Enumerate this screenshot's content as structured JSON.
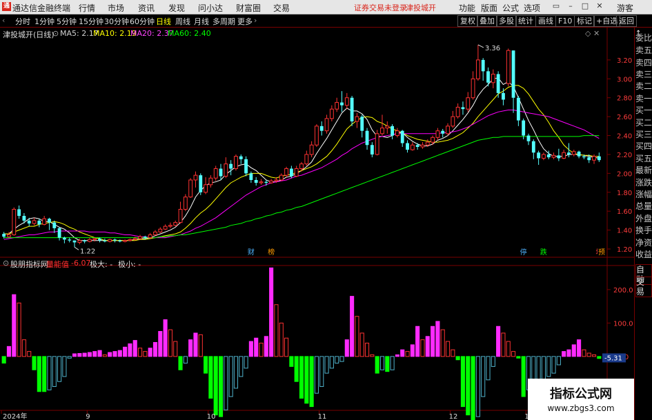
{
  "app": {
    "title": "通达信金融终端",
    "logo": "通",
    "menus": [
      "行情",
      "市场",
      "资讯",
      "发现",
      "问小达",
      "财富圈",
      "交易"
    ],
    "notice": "证券交易未登录",
    "stock_link": "津投城开",
    "right_menus": [
      "功能",
      "版面",
      "公式",
      "选项"
    ],
    "guest": "游客"
  },
  "toolbar": {
    "periods": [
      "分时",
      "1分钟",
      "5分钟",
      "15分钟",
      "30分钟",
      "60分钟",
      "日线",
      "周线",
      "月线",
      "多周期",
      "更多"
    ],
    "active_period": "日线",
    "right_buttons": [
      "复权",
      "叠加",
      "多股",
      "统计",
      "画线",
      "F10",
      "标记",
      "+自选",
      "返回"
    ]
  },
  "main_chart": {
    "stock_title": "津投城开(日线)",
    "ma_labels": [
      "MA5: 2.17",
      "MA10: 2.19",
      "MA20: 2.37",
      "MA60: 2.40"
    ],
    "ma_colors": [
      "#ffffff",
      "#ffff00",
      "#ff00ff",
      "#00ff00"
    ],
    "y_ticks": [
      "3.20",
      "3.00",
      "2.80",
      "2.60",
      "2.40",
      "2.20",
      "2.00",
      "1.80",
      "1.60",
      "1.40",
      "1.20"
    ],
    "y_tick_values": [
      3.2,
      3.0,
      2.8,
      2.6,
      2.4,
      2.2,
      2.0,
      1.8,
      1.6,
      1.4,
      1.2
    ],
    "price_range": [
      1.12,
      3.44
    ],
    "high_label": "3.36",
    "low_label": "1.22",
    "event_marks": [
      "财",
      "榜",
      "停",
      "跌",
      "增",
      "预"
    ],
    "event_colors": [
      "#4fb3ff",
      "#ff9a00",
      "#4fb3ff",
      "#00ff00",
      "#ff4040",
      "#ff9a00"
    ],
    "candles": [
      [
        1.36,
        1.33,
        1.31,
        1.38
      ],
      [
        1.33,
        1.35,
        1.32,
        1.38
      ],
      [
        1.35,
        1.62,
        1.34,
        1.64
      ],
      [
        1.62,
        1.55,
        1.52,
        1.66
      ],
      [
        1.55,
        1.5,
        1.47,
        1.58
      ],
      [
        1.5,
        1.47,
        1.44,
        1.53
      ],
      [
        1.47,
        1.5,
        1.45,
        1.53
      ],
      [
        1.5,
        1.46,
        1.43,
        1.52
      ],
      [
        1.46,
        1.52,
        1.45,
        1.55
      ],
      [
        1.52,
        1.48,
        1.4,
        1.53
      ],
      [
        1.48,
        1.42,
        1.37,
        1.5
      ],
      [
        1.42,
        1.32,
        1.29,
        1.43
      ],
      [
        1.32,
        1.3,
        1.26,
        1.33
      ],
      [
        1.3,
        1.29,
        1.27,
        1.32
      ],
      [
        1.29,
        1.27,
        1.22,
        1.29
      ],
      [
        1.27,
        1.29,
        1.25,
        1.31
      ],
      [
        1.29,
        1.28,
        1.26,
        1.3
      ],
      [
        1.28,
        1.3,
        1.27,
        1.32
      ],
      [
        1.3,
        1.31,
        1.28,
        1.32
      ],
      [
        1.31,
        1.29,
        1.27,
        1.32
      ],
      [
        1.29,
        1.28,
        1.27,
        1.31
      ],
      [
        1.28,
        1.3,
        1.27,
        1.31
      ],
      [
        1.3,
        1.29,
        1.27,
        1.31
      ],
      [
        1.29,
        1.28,
        1.27,
        1.3
      ],
      [
        1.28,
        1.29,
        1.27,
        1.3
      ],
      [
        1.29,
        1.3,
        1.28,
        1.31
      ],
      [
        1.3,
        1.31,
        1.29,
        1.33
      ],
      [
        1.31,
        1.33,
        1.3,
        1.35
      ],
      [
        1.33,
        1.32,
        1.3,
        1.34
      ],
      [
        1.32,
        1.35,
        1.31,
        1.37
      ],
      [
        1.35,
        1.38,
        1.34,
        1.4
      ],
      [
        1.38,
        1.41,
        1.37,
        1.43
      ],
      [
        1.41,
        1.44,
        1.4,
        1.46
      ],
      [
        1.44,
        1.45,
        1.42,
        1.48
      ],
      [
        1.45,
        1.48,
        1.44,
        1.5
      ],
      [
        1.48,
        1.62,
        1.47,
        1.7
      ],
      [
        1.62,
        1.75,
        1.6,
        1.78
      ],
      [
        1.75,
        1.93,
        1.74,
        1.95
      ],
      [
        1.93,
        1.98,
        1.85,
        2.02
      ],
      [
        1.98,
        1.8,
        1.77,
        2.0
      ],
      [
        1.8,
        1.88,
        1.78,
        1.96
      ],
      [
        1.88,
        1.95,
        1.85,
        1.98
      ],
      [
        1.95,
        2.05,
        1.92,
        2.08
      ],
      [
        2.05,
        1.97,
        1.93,
        2.1
      ],
      [
        1.97,
        2.1,
        1.95,
        2.17
      ],
      [
        2.1,
        2.05,
        1.98,
        2.14
      ],
      [
        2.05,
        2.18,
        2.03,
        2.2
      ],
      [
        2.18,
        2.15,
        2.1,
        2.2
      ],
      [
        2.15,
        2.0,
        1.97,
        2.18
      ],
      [
        2.0,
        1.93,
        1.9,
        2.02
      ],
      [
        1.93,
        1.9,
        1.87,
        1.96
      ],
      [
        1.9,
        1.91,
        1.88,
        1.94
      ],
      [
        1.91,
        1.9,
        1.87,
        1.93
      ],
      [
        1.9,
        1.92,
        1.89,
        1.94
      ],
      [
        1.92,
        1.93,
        1.9,
        1.96
      ],
      [
        1.93,
        1.98,
        1.92,
        2.0
      ],
      [
        1.98,
        2.05,
        1.96,
        2.07
      ],
      [
        2.05,
        1.97,
        1.95,
        2.08
      ],
      [
        1.97,
        2.05,
        1.96,
        2.08
      ],
      [
        2.05,
        2.1,
        2.02,
        2.12
      ],
      [
        2.1,
        2.2,
        2.08,
        2.24
      ],
      [
        2.2,
        2.3,
        2.17,
        2.34
      ],
      [
        2.3,
        2.5,
        2.28,
        2.52
      ],
      [
        2.5,
        2.45,
        2.4,
        2.55
      ],
      [
        2.45,
        2.58,
        2.42,
        2.62
      ],
      [
        2.58,
        2.68,
        2.55,
        2.72
      ],
      [
        2.68,
        2.75,
        2.65,
        2.8
      ],
      [
        2.75,
        2.72,
        2.65,
        2.87
      ],
      [
        2.72,
        2.8,
        2.68,
        2.85
      ],
      [
        2.8,
        2.55,
        2.5,
        2.82
      ],
      [
        2.55,
        2.6,
        2.48,
        2.64
      ],
      [
        2.6,
        2.45,
        2.38,
        2.62
      ],
      [
        2.45,
        2.3,
        2.25,
        2.48
      ],
      [
        2.3,
        2.2,
        2.17,
        2.33
      ],
      [
        2.2,
        2.42,
        2.19,
        2.46
      ],
      [
        2.42,
        2.48,
        2.4,
        2.62
      ],
      [
        2.48,
        2.5,
        2.42,
        2.55
      ],
      [
        2.5,
        2.4,
        2.36,
        2.52
      ],
      [
        2.4,
        2.45,
        2.38,
        2.48
      ],
      [
        2.45,
        2.32,
        2.28,
        2.46
      ],
      [
        2.32,
        2.25,
        2.22,
        2.35
      ],
      [
        2.25,
        2.3,
        2.24,
        2.33
      ],
      [
        2.3,
        2.28,
        2.25,
        2.32
      ],
      [
        2.28,
        2.3,
        2.26,
        2.33
      ],
      [
        2.3,
        2.33,
        2.28,
        2.36
      ],
      [
        2.33,
        2.38,
        2.3,
        2.4
      ],
      [
        2.38,
        2.45,
        2.35,
        2.48
      ],
      [
        2.45,
        2.42,
        2.38,
        2.47
      ],
      [
        2.42,
        2.5,
        2.4,
        2.53
      ],
      [
        2.5,
        2.6,
        2.48,
        2.66
      ],
      [
        2.6,
        2.7,
        2.58,
        2.74
      ],
      [
        2.7,
        2.68,
        2.62,
        2.76
      ],
      [
        2.68,
        2.8,
        2.65,
        2.86
      ],
      [
        2.8,
        3.0,
        2.78,
        3.08
      ],
      [
        3.0,
        3.2,
        2.98,
        3.36
      ],
      [
        3.2,
        3.08,
        2.98,
        3.22
      ],
      [
        3.08,
        2.96,
        2.92,
        3.12
      ],
      [
        2.96,
        3.05,
        2.9,
        3.1
      ],
      [
        3.05,
        2.85,
        2.8,
        3.08
      ],
      [
        2.85,
        2.78,
        2.72,
        2.9
      ],
      [
        2.95,
        3.3,
        2.92,
        3.32
      ],
      [
        3.3,
        2.8,
        2.64,
        3.3
      ],
      [
        2.8,
        2.56,
        2.5,
        2.82
      ],
      [
        2.56,
        2.4,
        2.36,
        2.58
      ],
      [
        2.4,
        2.34,
        2.3,
        2.42
      ],
      [
        2.34,
        2.22,
        2.15,
        2.36
      ],
      [
        2.22,
        2.16,
        2.09,
        2.24
      ],
      [
        2.16,
        2.2,
        2.14,
        2.22
      ],
      [
        2.2,
        2.17,
        2.15,
        2.24
      ],
      [
        2.17,
        2.19,
        2.15,
        2.22
      ],
      [
        2.19,
        2.16,
        2.13,
        2.26
      ],
      [
        2.16,
        2.22,
        2.15,
        2.25
      ],
      [
        2.22,
        2.2,
        2.17,
        2.32
      ],
      [
        2.2,
        2.23,
        2.18,
        2.25
      ],
      [
        2.23,
        2.18,
        2.16,
        2.24
      ],
      [
        2.18,
        2.17,
        2.15,
        2.2
      ],
      [
        2.17,
        2.14,
        2.11,
        2.2
      ],
      [
        2.14,
        2.18,
        2.1,
        2.2
      ],
      [
        2.18,
        2.14,
        2.12,
        2.22
      ]
    ],
    "ma5": [
      1.36,
      1.36,
      1.41,
      1.45,
      1.48,
      1.52,
      1.53,
      1.52,
      1.49,
      1.49,
      1.46,
      1.43,
      1.41,
      1.37,
      1.32,
      1.29,
      1.29,
      1.29,
      1.29,
      1.29,
      1.29,
      1.29,
      1.29,
      1.29,
      1.29,
      1.29,
      1.3,
      1.31,
      1.31,
      1.32,
      1.34,
      1.36,
      1.38,
      1.4,
      1.43,
      1.48,
      1.55,
      1.64,
      1.75,
      1.82,
      1.87,
      1.9,
      1.91,
      1.93,
      1.99,
      2.03,
      2.07,
      2.09,
      2.1,
      2.06,
      2.03,
      1.98,
      1.93,
      1.91,
      1.91,
      1.93,
      1.96,
      1.97,
      2.0,
      2.03,
      2.07,
      2.12,
      2.21,
      2.29,
      2.37,
      2.46,
      2.55,
      2.64,
      2.69,
      2.66,
      2.66,
      2.63,
      2.57,
      2.46,
      2.39,
      2.39,
      2.38,
      2.4,
      2.43,
      2.43,
      2.38,
      2.34,
      2.31,
      2.29,
      2.29,
      2.31,
      2.35,
      2.37,
      2.4,
      2.45,
      2.51,
      2.57,
      2.64,
      2.72,
      2.82,
      2.89,
      2.94,
      3.0,
      3.01,
      2.94,
      2.97,
      2.92,
      2.8,
      2.68,
      2.56,
      2.46,
      2.35,
      2.26,
      2.21,
      2.18,
      2.18,
      2.18,
      2.2,
      2.2,
      2.2,
      2.19,
      2.18,
      2.17,
      2.16
    ],
    "ma10": [
      1.36,
      1.36,
      1.38,
      1.4,
      1.42,
      1.44,
      1.44,
      1.46,
      1.47,
      1.48,
      1.49,
      1.48,
      1.46,
      1.43,
      1.41,
      1.38,
      1.36,
      1.34,
      1.32,
      1.31,
      1.29,
      1.29,
      1.29,
      1.29,
      1.29,
      1.29,
      1.29,
      1.3,
      1.3,
      1.31,
      1.32,
      1.33,
      1.34,
      1.35,
      1.36,
      1.38,
      1.42,
      1.47,
      1.53,
      1.58,
      1.62,
      1.67,
      1.73,
      1.79,
      1.85,
      1.9,
      1.93,
      1.96,
      1.98,
      2.0,
      2.0,
      2.0,
      1.98,
      1.96,
      1.95,
      1.97,
      1.98,
      1.99,
      2.01,
      2.03,
      2.05,
      2.07,
      2.1,
      2.14,
      2.18,
      2.24,
      2.31,
      2.39,
      2.47,
      2.52,
      2.56,
      2.59,
      2.6,
      2.59,
      2.55,
      2.53,
      2.5,
      2.47,
      2.45,
      2.43,
      2.4,
      2.38,
      2.36,
      2.35,
      2.34,
      2.33,
      2.33,
      2.34,
      2.35,
      2.37,
      2.4,
      2.43,
      2.48,
      2.53,
      2.6,
      2.66,
      2.72,
      2.78,
      2.84,
      2.87,
      2.91,
      2.93,
      2.93,
      2.9,
      2.84,
      2.76,
      2.68,
      2.62,
      2.54,
      2.45,
      2.38,
      2.3,
      2.25,
      2.21,
      2.2,
      2.19,
      2.19,
      2.18,
      2.18
    ],
    "ma20": [
      1.3,
      1.31,
      1.32,
      1.33,
      1.34,
      1.35,
      1.35,
      1.36,
      1.37,
      1.38,
      1.38,
      1.39,
      1.39,
      1.39,
      1.39,
      1.39,
      1.39,
      1.38,
      1.38,
      1.38,
      1.38,
      1.37,
      1.37,
      1.36,
      1.35,
      1.35,
      1.34,
      1.33,
      1.33,
      1.32,
      1.32,
      1.32,
      1.32,
      1.33,
      1.34,
      1.35,
      1.37,
      1.39,
      1.42,
      1.44,
      1.47,
      1.5,
      1.53,
      1.57,
      1.61,
      1.65,
      1.69,
      1.73,
      1.77,
      1.8,
      1.83,
      1.86,
      1.88,
      1.9,
      1.91,
      1.92,
      1.93,
      1.95,
      1.97,
      1.98,
      2.0,
      2.02,
      2.04,
      2.06,
      2.09,
      2.12,
      2.15,
      2.19,
      2.22,
      2.26,
      2.29,
      2.32,
      2.34,
      2.36,
      2.38,
      2.39,
      2.4,
      2.41,
      2.42,
      2.42,
      2.42,
      2.42,
      2.42,
      2.42,
      2.42,
      2.42,
      2.42,
      2.43,
      2.43,
      2.44,
      2.45,
      2.47,
      2.49,
      2.52,
      2.55,
      2.58,
      2.61,
      2.63,
      2.65,
      2.66,
      2.67,
      2.67,
      2.66,
      2.65,
      2.64,
      2.63,
      2.62,
      2.61,
      2.6,
      2.58,
      2.56,
      2.54,
      2.52,
      2.5,
      2.48,
      2.46,
      2.43,
      2.4,
      2.37
    ],
    "ma60": [
      1.32,
      1.32,
      1.32,
      1.32,
      1.32,
      1.32,
      1.32,
      1.32,
      1.32,
      1.32,
      1.32,
      1.32,
      1.32,
      1.32,
      1.32,
      1.32,
      1.32,
      1.32,
      1.32,
      1.32,
      1.32,
      1.32,
      1.32,
      1.32,
      1.32,
      1.32,
      1.32,
      1.32,
      1.32,
      1.32,
      1.32,
      1.33,
      1.33,
      1.34,
      1.34,
      1.35,
      1.35,
      1.36,
      1.37,
      1.38,
      1.39,
      1.4,
      1.41,
      1.42,
      1.43,
      1.45,
      1.46,
      1.47,
      1.49,
      1.5,
      1.52,
      1.53,
      1.55,
      1.56,
      1.58,
      1.59,
      1.61,
      1.62,
      1.64,
      1.65,
      1.67,
      1.69,
      1.71,
      1.73,
      1.75,
      1.77,
      1.79,
      1.81,
      1.83,
      1.85,
      1.87,
      1.89,
      1.91,
      1.93,
      1.95,
      1.97,
      1.99,
      2.01,
      2.03,
      2.05,
      2.07,
      2.09,
      2.11,
      2.13,
      2.15,
      2.17,
      2.19,
      2.21,
      2.23,
      2.25,
      2.27,
      2.29,
      2.31,
      2.33,
      2.35,
      2.36,
      2.37,
      2.38,
      2.38,
      2.39,
      2.39,
      2.39,
      2.39,
      2.39,
      2.39,
      2.39,
      2.39,
      2.39,
      2.39,
      2.39,
      2.39,
      2.39,
      2.39,
      2.39,
      2.39,
      2.4,
      2.4,
      2.4,
      2.4
    ]
  },
  "indicator": {
    "name": "股朋指标网",
    "value_label": "量能值",
    "value": "-6.07",
    "max_text": "极大: -",
    "min_text": "极小: -",
    "y_ticks": [
      "200.0",
      "100.0",
      "0.00",
      "-100.0"
    ],
    "y_tick_values": [
      200,
      100,
      0,
      -100
    ],
    "range": [
      -155,
      270
    ],
    "current_value_badge": "-5.31",
    "bars": [
      -20,
      30,
      185,
      160,
      50,
      15,
      -40,
      -105,
      -105,
      -100,
      -90,
      -75,
      -60,
      -5,
      8,
      9,
      10,
      12,
      15,
      18,
      5,
      12,
      15,
      18,
      28,
      38,
      48,
      25,
      15,
      25,
      42,
      75,
      110,
      80,
      45,
      -40,
      -20,
      50,
      70,
      65,
      -50,
      -125,
      -175,
      -180,
      -160,
      -120,
      -95,
      -60,
      -35,
      45,
      55,
      40,
      60,
      265,
      155,
      100,
      55,
      -30,
      -75,
      -125,
      -140,
      -150,
      -110,
      -90,
      -50,
      -35,
      -20,
      -15,
      50,
      180,
      120,
      70,
      40,
      5,
      -50,
      -40,
      -45,
      -40,
      5,
      20,
      15,
      35,
      90,
      50,
      60,
      90,
      105,
      80,
      45,
      20,
      -10,
      -150,
      -175,
      -210,
      -180,
      -120,
      -70,
      -30,
      90,
      70,
      45,
      15,
      -5,
      -120,
      -100,
      -95,
      -85,
      -75,
      -60,
      -50,
      -25,
      15,
      20,
      35,
      50,
      20,
      10,
      5,
      -6
    ]
  },
  "x_axis": {
    "labels": [
      "2024年",
      "9",
      "10",
      "11",
      "12",
      "1"
    ],
    "label_index": [
      0,
      17,
      41,
      63,
      89,
      104
    ]
  },
  "right_panel": {
    "items": [
      "委比",
      "卖五",
      "卖四",
      "卖三",
      "卖二",
      "卖一",
      "买一",
      "买二",
      "买三",
      "买四",
      "买五",
      "最新",
      "涨跌",
      "涨幅",
      "总量",
      "外盘",
      "换手",
      "净资",
      "收益",
      "自动",
      "交易"
    ]
  },
  "watermark": {
    "line1": "指标公式网",
    "line2": "www.zbgs3.com"
  }
}
